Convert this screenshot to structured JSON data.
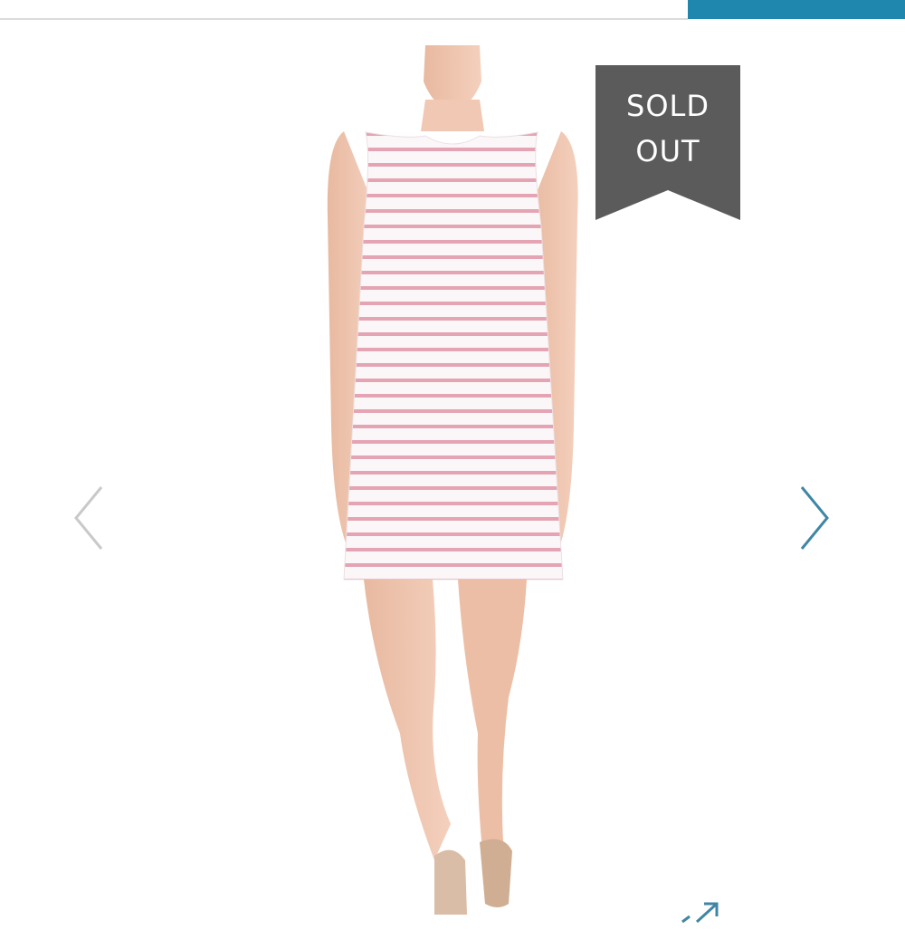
{
  "header": {
    "accent_color": "#1f86ad",
    "divider_color": "#dcdcdc"
  },
  "gallery": {
    "image_alt": "product-photo-striped-shift-dress",
    "prev_icon": "chevron-left-icon",
    "next_icon": "chevron-right-icon",
    "expand_icon": "expand-arrow-icon",
    "arrow_color_inactive": "#c9c9c9",
    "arrow_color_active": "#3f86a6"
  },
  "badge": {
    "line1": "SOLD",
    "line2": "OUT",
    "color": "#5b5b5b"
  }
}
